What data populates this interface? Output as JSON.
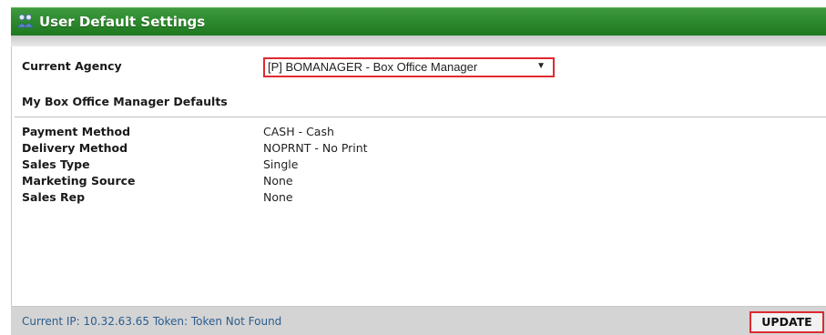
{
  "header": {
    "title": "User Default Settings",
    "icon": "users-icon"
  },
  "agency": {
    "label": "Current Agency",
    "selected": "[P] BOMANAGER - Box Office Manager",
    "arrow": "▼"
  },
  "defaults": {
    "heading": "My Box Office Manager Defaults",
    "fields": [
      {
        "label": "Payment Method",
        "value": "CASH - Cash"
      },
      {
        "label": "Delivery Method",
        "value": "NOPRNT - No Print"
      },
      {
        "label": "Sales Type",
        "value": "Single"
      },
      {
        "label": "Marketing Source",
        "value": "None"
      },
      {
        "label": "Sales Rep",
        "value": "None"
      }
    ]
  },
  "footer": {
    "status": "Current IP: 10.32.63.65  Token: Token Not Found",
    "update_label": "UPDATE"
  },
  "colors": {
    "header_green": "#2e8a2e",
    "highlight_red": "#e0292f",
    "status_blue": "#2a5d8f"
  }
}
